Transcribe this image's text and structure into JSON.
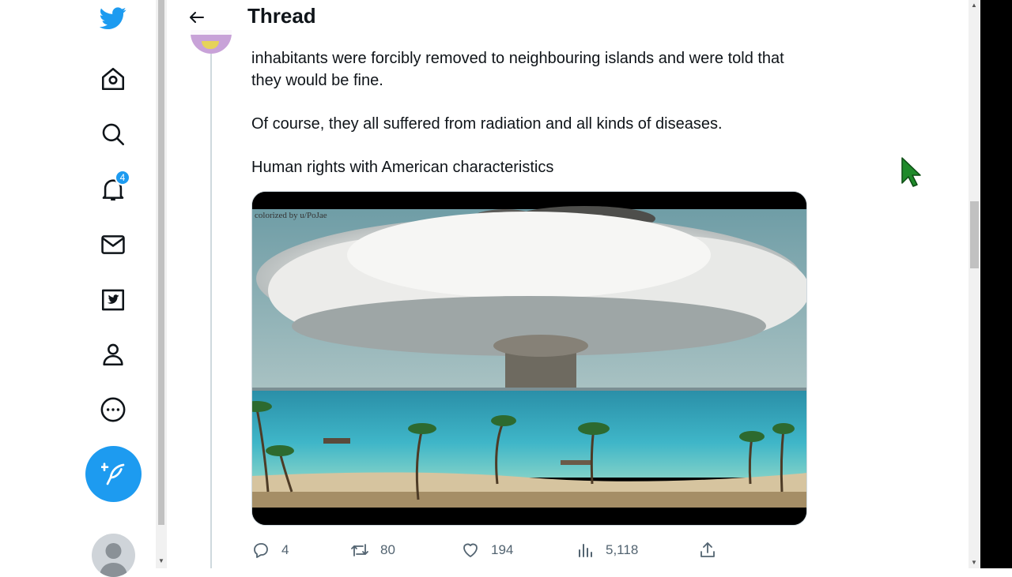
{
  "header": {
    "title": "Thread"
  },
  "nav": {
    "items": [
      {
        "name": "twitter-logo-icon"
      },
      {
        "name": "home-icon"
      },
      {
        "name": "search-icon"
      },
      {
        "name": "notifications-icon"
      },
      {
        "name": "messages-icon"
      },
      {
        "name": "twitter-blue-icon"
      },
      {
        "name": "profile-icon"
      },
      {
        "name": "more-icon"
      }
    ],
    "notification_count": "4"
  },
  "tweet": {
    "paragraphs": [
      "inhabitants were forcibly removed to neighbouring islands and were told that they would be fine.",
      "Of course, they all suffered from radiation and all kinds of diseases.",
      "Human rights with American characteristics"
    ],
    "media_credit": "colorized by u/PoJae",
    "stats": {
      "replies": "4",
      "retweets": "80",
      "likes": "194",
      "views": "5,118"
    }
  },
  "colors": {
    "accent": "#1d9bf0",
    "text": "#0f1419",
    "secondary": "#536471"
  }
}
